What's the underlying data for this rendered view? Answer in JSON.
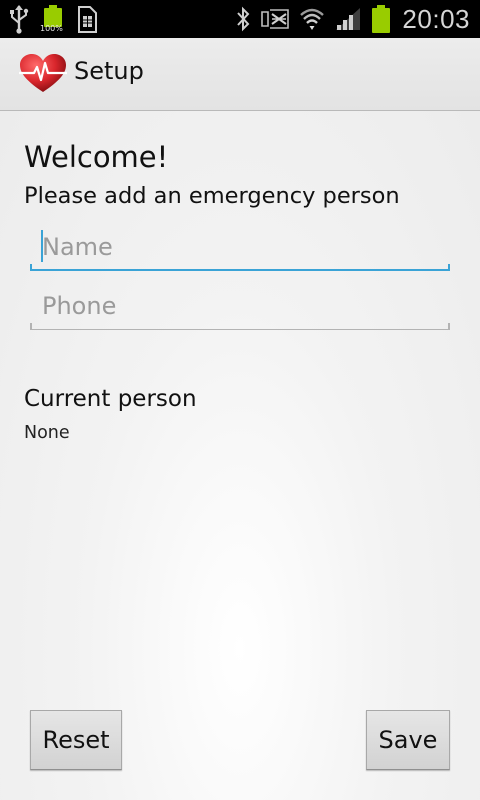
{
  "status_bar": {
    "time": "20:03",
    "battery_level_text": "100%",
    "icons": [
      "usb-icon",
      "battery-full-icon",
      "sim-card-icon",
      "bluetooth-icon",
      "signal-off-icon",
      "wifi-icon",
      "cell-signal-icon",
      "battery-icon"
    ],
    "battery_color": "#99cc00"
  },
  "action_bar": {
    "title": "Setup",
    "logo_icon": "heart-pulse-icon",
    "logo_color": "#d9262c"
  },
  "content": {
    "welcome": "Welcome!",
    "subtitle": "Please add an emergency person",
    "name_field": {
      "value": "",
      "placeholder": "Name",
      "focused": true
    },
    "phone_field": {
      "value": "",
      "placeholder": "Phone",
      "focused": false
    },
    "current_person_label": "Current person",
    "current_person_value": "None",
    "accent_color": "#3aa3d6"
  },
  "buttons": {
    "reset_label": "Reset",
    "save_label": "Save"
  }
}
